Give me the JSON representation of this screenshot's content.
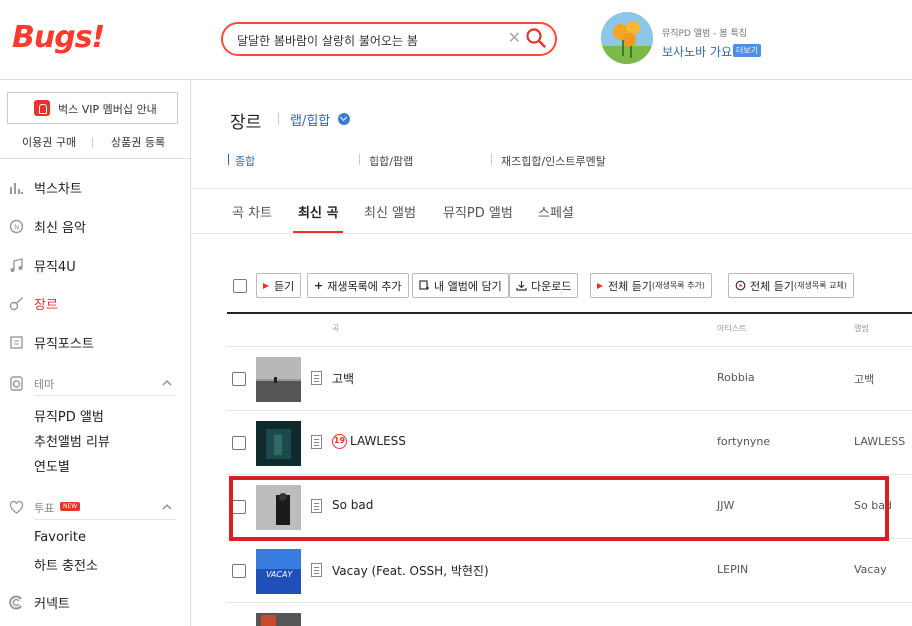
{
  "header": {
    "logo": "Bugs!",
    "search_value": "달달한 봄바람이 살랑히 불어오는 봄",
    "promo_sub": "뮤직PD 앨범 - 봄 특집",
    "promo_title": "보사노바 가요",
    "promo_more": "더보기"
  },
  "sidebar": {
    "vip_label": "벅스 VIP 멤버십 안내",
    "sub_links": [
      "이용권 구매",
      "상품권 등록"
    ],
    "nav": [
      {
        "label": "벅스차트",
        "icon": "chart-icon"
      },
      {
        "label": "최신 음악",
        "icon": "new-music-icon"
      },
      {
        "label": "뮤직4U",
        "icon": "note-icon"
      },
      {
        "label": "장르",
        "icon": "guitar-icon",
        "active": true
      },
      {
        "label": "뮤직포스트",
        "icon": "post-icon"
      }
    ],
    "theme": {
      "label": "테마",
      "items": [
        "뮤직PD 앨범",
        "추천앨범 리뷰",
        "연도별"
      ]
    },
    "vote": {
      "label": "투표",
      "badge": "NEW",
      "items": [
        "Favorite",
        "하트 충전소"
      ]
    },
    "connect": {
      "label": "커넥트"
    }
  },
  "main": {
    "page_title": "장르",
    "genre": "랩/힙합",
    "subgenres": [
      "종합",
      "힙합/팝랩",
      "재즈힙합/인스트루멘탈"
    ],
    "tabs": [
      "곡 차트",
      "최신 곡",
      "최신 앨범",
      "뮤직PD 앨범",
      "스페셜"
    ],
    "active_tab": 1,
    "toolbar": {
      "play": "듣기",
      "add_playlist": "재생목록에 추가",
      "add_album": "내 앨범에 담기",
      "download": "다운로드",
      "play_all_add": "전체 듣기",
      "play_all_add_sub": "(재생목록 추가)",
      "play_all_replace": "전체 듣기",
      "play_all_replace_sub": "(재생목록 교체)"
    },
    "columns": {
      "song": "곡",
      "artist": "아티스트",
      "album": "앨범"
    },
    "rows": [
      {
        "title": "고백",
        "artist": "Robbia",
        "album": "고백",
        "age": ""
      },
      {
        "title": "LAWLESS",
        "artist": "fortynyne",
        "album": "LAWLESS",
        "age": "19"
      },
      {
        "title": "So bad",
        "artist": "JJW",
        "album": "So bad",
        "age": ""
      },
      {
        "title": "Vacay (Feat. OSSH, 박현진)",
        "artist": "LEPIN",
        "album": "Vacay",
        "age": ""
      }
    ]
  },
  "colors": {
    "brand": "#ff3a2c",
    "accent_blue": "#2b6cb8",
    "highlight": "#d9201e"
  }
}
